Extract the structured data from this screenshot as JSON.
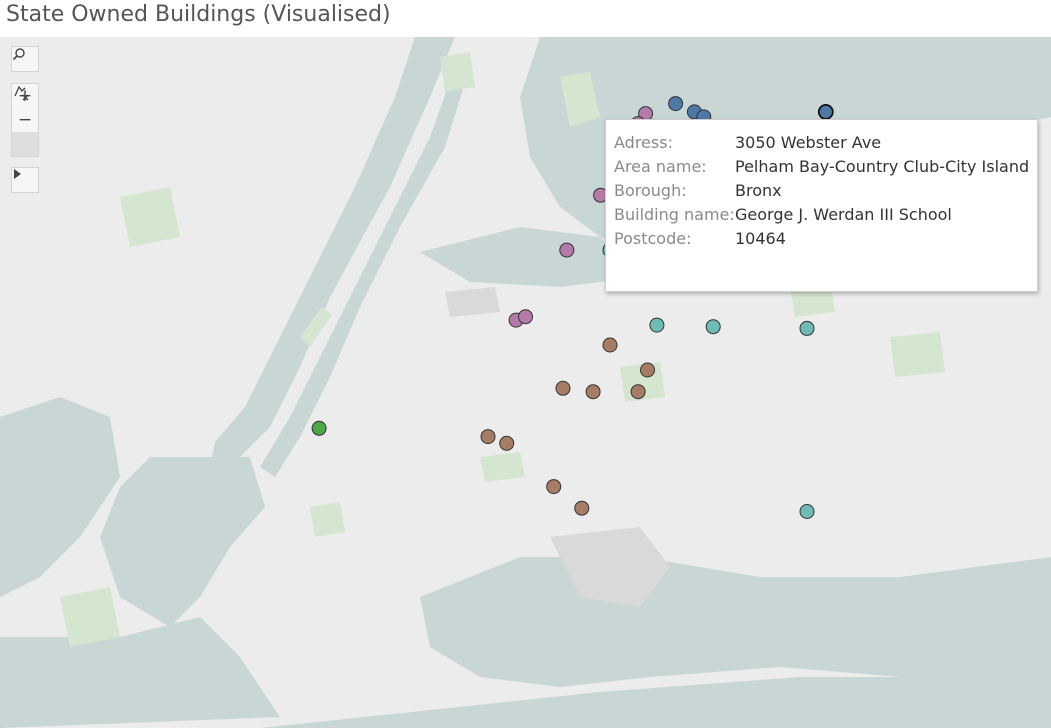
{
  "title": "State Owned Buildings (Visualised)",
  "controls": {
    "search_icon": "magnifier-icon",
    "zoom_in_glyph": "+",
    "zoom_out_glyph": "−",
    "reset_icon": "pin-clear-icon",
    "expand_glyph": "▶"
  },
  "colors": {
    "water": "#c9d6d6",
    "land": "#ececec",
    "park": "#d5e6d0",
    "Bronx": "#4e79a7",
    "Manhattan": "#b57aa9",
    "Queens": "#6fbcb4",
    "Brooklyn": "#a67c64",
    "Staten Island": "#4fa64a"
  },
  "markers": [
    {
      "borough": "Bronx",
      "lon": -73.9,
      "lat": 40.875
    },
    {
      "borough": "Bronx",
      "lon": -73.89,
      "lat": 40.87
    },
    {
      "borough": "Bronx",
      "lon": -73.885,
      "lat": 40.867
    },
    {
      "borough": "Bronx",
      "lon": -73.91,
      "lat": 40.861
    },
    {
      "borough": "Bronx",
      "lon": -73.915,
      "lat": 40.852
    },
    {
      "borough": "Bronx",
      "lon": -73.88,
      "lat": 40.856
    },
    {
      "borough": "Bronx",
      "lon": -73.874,
      "lat": 40.846
    },
    {
      "borough": "Bronx",
      "lon": -73.82,
      "lat": 40.87,
      "selected": true
    },
    {
      "borough": "Manhattan",
      "lon": -73.916,
      "lat": 40.869
    },
    {
      "borough": "Manhattan",
      "lon": -73.92,
      "lat": 40.863
    },
    {
      "borough": "Manhattan",
      "lon": -73.94,
      "lat": 40.82
    },
    {
      "borough": "Manhattan",
      "lon": -73.958,
      "lat": 40.787
    },
    {
      "borough": "Manhattan",
      "lon": -73.985,
      "lat": 40.745
    },
    {
      "borough": "Manhattan",
      "lon": -73.98,
      "lat": 40.747
    },
    {
      "borough": "Queens",
      "lon": -73.935,
      "lat": 40.787
    },
    {
      "borough": "Queens",
      "lon": -73.79,
      "lat": 40.775
    },
    {
      "borough": "Queens",
      "lon": -73.91,
      "lat": 40.742
    },
    {
      "borough": "Queens",
      "lon": -73.88,
      "lat": 40.741
    },
    {
      "borough": "Queens",
      "lon": -73.83,
      "lat": 40.74
    },
    {
      "borough": "Queens",
      "lon": -73.83,
      "lat": 40.63
    },
    {
      "borough": "Brooklyn",
      "lon": -73.935,
      "lat": 40.73
    },
    {
      "borough": "Brooklyn",
      "lon": -73.915,
      "lat": 40.715
    },
    {
      "borough": "Brooklyn",
      "lon": -73.96,
      "lat": 40.704
    },
    {
      "borough": "Brooklyn",
      "lon": -73.944,
      "lat": 40.702
    },
    {
      "borough": "Brooklyn",
      "lon": -73.92,
      "lat": 40.702
    },
    {
      "borough": "Brooklyn",
      "lon": -74.0,
      "lat": 40.675
    },
    {
      "borough": "Brooklyn",
      "lon": -73.99,
      "lat": 40.671
    },
    {
      "borough": "Brooklyn",
      "lon": -73.965,
      "lat": 40.645
    },
    {
      "borough": "Brooklyn",
      "lon": -73.95,
      "lat": 40.632
    },
    {
      "borough": "Staten Island",
      "lon": -74.09,
      "lat": 40.68
    }
  ],
  "tooltip": {
    "rows": [
      {
        "label": "Adress:",
        "value": "3050 Webster Ave"
      },
      {
        "label": "Area name:",
        "value": "Pelham Bay-Country Club-City Island"
      },
      {
        "label": "Borough:",
        "value": "Bronx"
      },
      {
        "label": "Building name:",
        "value": "George J. Werdan III School"
      },
      {
        "label": "Postcode:",
        "value": "10464"
      }
    ]
  }
}
